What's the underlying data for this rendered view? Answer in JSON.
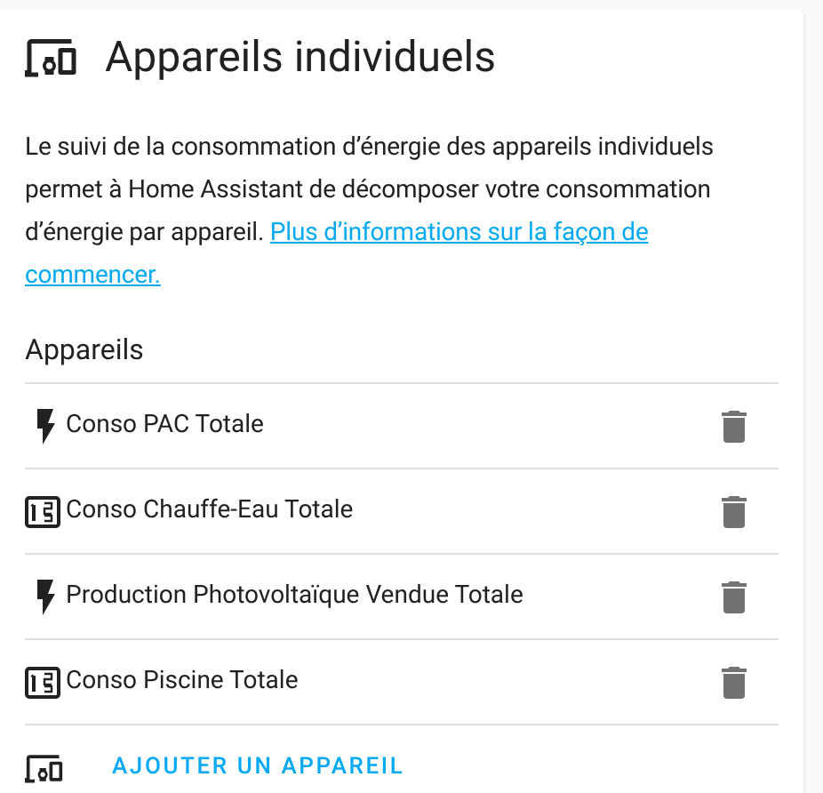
{
  "card": {
    "title": "Appareils individuels",
    "description": "Le suivi de la consommation d’énergie des appareils individuels permet à Home Assistant de décomposer votre consommation d’énergie par appareil.",
    "link_lines": [
      "Plus d’informations sur la façon de",
      "commencer."
    ]
  },
  "devices_heading": "Appareils",
  "devices": [
    {
      "kind": "power",
      "name": "Conso PAC Totale"
    },
    {
      "kind": "counter",
      "name": "Conso Chauffe-Eau Totale"
    },
    {
      "kind": "power",
      "name": "Production Photovoltaïque Vendue Totale"
    },
    {
      "kind": "counter",
      "name": "Conso Piscine Totale"
    }
  ],
  "add_button": "AJOUTER UN APPAREIL"
}
